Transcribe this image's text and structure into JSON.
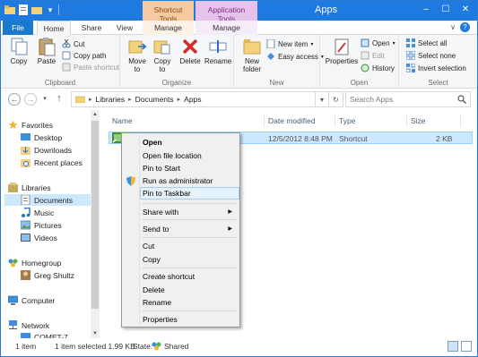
{
  "window": {
    "title": "Apps",
    "context_tabs": [
      "Shortcut Tools",
      "Application Tools"
    ],
    "controls": [
      "–",
      "☐",
      "✕"
    ]
  },
  "ribbon_tabs": [
    "File",
    "Home",
    "Share",
    "View",
    "Manage",
    "Manage"
  ],
  "ribbon": {
    "clipboard": {
      "label": "Clipboard",
      "copy": "Copy",
      "paste": "Paste",
      "cut": "Cut",
      "copy_path": "Copy path",
      "paste_shortcut": "Paste shortcut"
    },
    "organize": {
      "label": "Organize",
      "move_to": [
        "Move",
        "to"
      ],
      "copy_to": [
        "Copy",
        "to"
      ],
      "delete": "Delete",
      "rename": "Rename"
    },
    "new": {
      "label": "New",
      "new_folder": [
        "New",
        "folder"
      ],
      "new_item": "New item",
      "easy_access": "Easy access"
    },
    "open": {
      "label": "Open",
      "properties": "Properties",
      "open": "Open",
      "edit": "Edit",
      "history": "History"
    },
    "select": {
      "label": "Select",
      "select_all": "Select all",
      "select_none": "Select none",
      "invert": "Invert selection"
    }
  },
  "address": {
    "crumbs": [
      "Libraries",
      "Documents",
      "Apps"
    ],
    "search_placeholder": "Search Apps"
  },
  "nav": {
    "favorites": "Favorites",
    "desktop": "Desktop",
    "downloads": "Downloads",
    "recent": "Recent places",
    "libraries": "Libraries",
    "documents": "Documents",
    "music": "Music",
    "pictures": "Pictures",
    "videos": "Videos",
    "homegroup": "Homegroup",
    "greg": "Greg Shultz",
    "computer": "Computer",
    "network": "Network",
    "comet": "COMET-7"
  },
  "columns": [
    "Name",
    "Date modified",
    "Type",
    "Size"
  ],
  "file": {
    "date": "12/5/2012 8:48 PM",
    "type": "Shortcut",
    "size": "2 KB"
  },
  "context_menu": {
    "open": "Open",
    "open_location": "Open file location",
    "pin_start": "Pin to Start",
    "run_admin": "Run as administrator",
    "pin_taskbar": "Pin to Taskbar",
    "share_with": "Share with",
    "send_to": "Send to",
    "cut": "Cut",
    "copy": "Copy",
    "create_shortcut": "Create shortcut",
    "delete": "Delete",
    "rename": "Rename",
    "properties": "Properties"
  },
  "status": {
    "count": "1 item",
    "selected": "1 item selected  1.99 KB",
    "state_label": "State:",
    "state_value": "Shared"
  },
  "colors": {
    "titlebar": "#1e7ae0",
    "file_tab": "#1979ca",
    "shortcut_tools": "#f7c9a0",
    "application_tools": "#e6c3eb",
    "selection": "#cce8ff"
  }
}
